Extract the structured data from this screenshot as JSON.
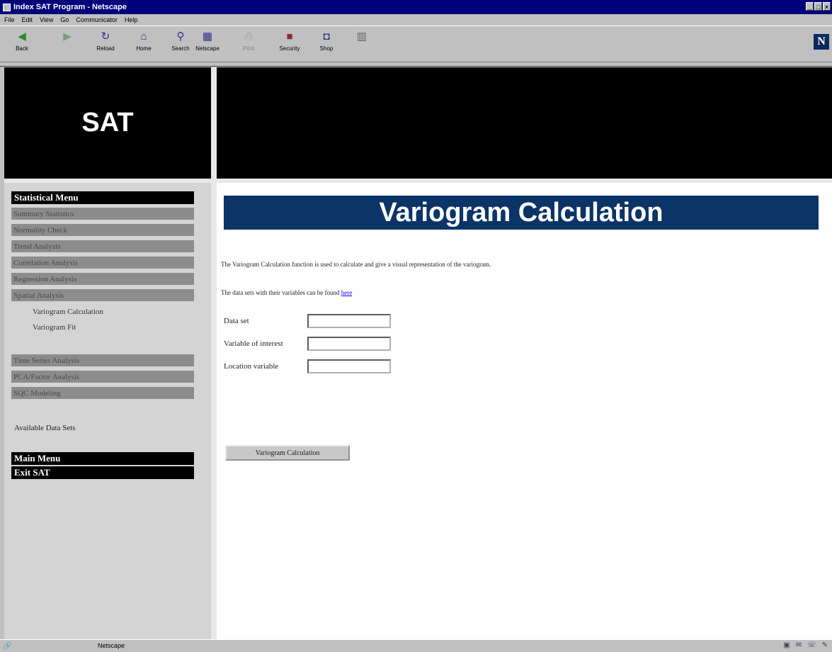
{
  "window": {
    "title": "Index SAT Program - Netscape",
    "controls": [
      "_",
      "□",
      "×"
    ]
  },
  "menu": [
    "File",
    "Edit",
    "View",
    "Go",
    "Communicator",
    "Help"
  ],
  "toolbar": {
    "buttons": [
      {
        "label": "Back",
        "icon": "back-arrow-icon",
        "glyph": "◀",
        "color": "#2a8a2a"
      },
      {
        "label": "",
        "icon": "forward-arrow-icon",
        "glyph": "▶",
        "color": "#2a8a2a",
        "disabled": true
      },
      {
        "label": "Reload",
        "icon": "reload-icon",
        "glyph": "↻",
        "color": "#303080"
      },
      {
        "label": "Home",
        "icon": "home-icon",
        "glyph": "⌂",
        "color": "#303080"
      },
      {
        "label": "Search",
        "icon": "search-icon",
        "glyph": "⚲",
        "color": "#303080"
      },
      {
        "label": "Netscape",
        "icon": "netscape-icon",
        "glyph": "▦",
        "color": "#303080"
      },
      {
        "label": "Print",
        "icon": "print-icon",
        "glyph": "⎙",
        "color": "#808080",
        "disabled": true
      },
      {
        "label": "Security",
        "icon": "lock-icon",
        "glyph": "🔒",
        "color": "#8a2a2a"
      },
      {
        "label": "Shop",
        "icon": "shop-icon",
        "glyph": "◘",
        "color": "#303080"
      },
      {
        "label": "",
        "icon": "stop-icon",
        "glyph": "▥",
        "color": "#606060"
      }
    ],
    "brand_letter": "N"
  },
  "logo": {
    "text": "SAT"
  },
  "nav": {
    "statistical_header": "Statistical Menu",
    "items": [
      "Summary Statistics",
      "Normality Check",
      "Trend Analysis",
      "Correlation Analysis",
      "Regression Analysis",
      "Spatial Analysis"
    ],
    "subitems": [
      "Variogram Calculation",
      "Variogram Fit"
    ],
    "items2": [
      "Time Series Analysis",
      "PCA/Factor Analysis",
      "SQC Modeling"
    ],
    "available": "Available Data Sets",
    "main_menu": "Main Menu",
    "exit": "Exit SAT"
  },
  "main": {
    "title": "Variogram Calculation",
    "description": "The Variogram Calculation function is used to calculate and give a visual representation of the variogram.",
    "datasets_text": "The data sets with their variables can be found",
    "datasets_link": "here",
    "fields": [
      {
        "label": "Data set",
        "value": ""
      },
      {
        "label": "Variable of interest",
        "value": ""
      },
      {
        "label": "Location variable",
        "value": ""
      }
    ],
    "submit_label": "Variogram Calculation"
  },
  "status": {
    "text": "Netscape"
  },
  "colors": {
    "title_bar": "#00007b",
    "page_title_bg": "#0b3467",
    "nav_item_bg": "#8c8c8c"
  }
}
